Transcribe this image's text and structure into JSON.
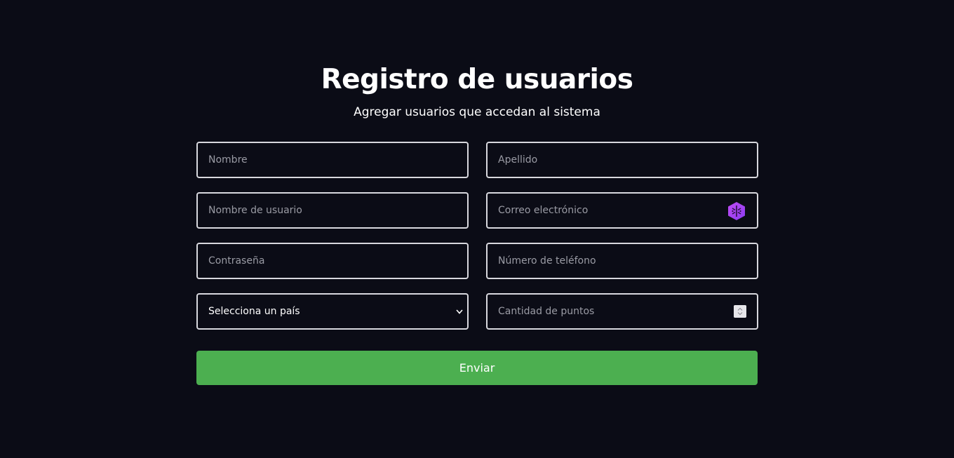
{
  "header": {
    "title": "Registro de usuarios",
    "subtitle": "Agregar usuarios que accedan al sistema"
  },
  "form": {
    "nombre": {
      "placeholder": "Nombre",
      "value": ""
    },
    "apellido": {
      "placeholder": "Apellido",
      "value": ""
    },
    "usuario": {
      "placeholder": "Nombre de usuario",
      "value": ""
    },
    "correo": {
      "placeholder": "Correo electrónico",
      "value": ""
    },
    "contrasena": {
      "placeholder": "Contraseña",
      "value": ""
    },
    "telefono": {
      "placeholder": "Número de teléfono",
      "value": ""
    },
    "pais": {
      "selected": "Selecciona un país"
    },
    "puntos": {
      "placeholder": "Cantidad de puntos",
      "value": ""
    },
    "submit_label": "Enviar"
  },
  "icons": {
    "email_extension": "password-manager-icon",
    "select_arrow": "chevron-down-icon",
    "number_spinner": "spinner-icon"
  },
  "colors": {
    "background": "#0b0c16",
    "accent": "#4caf50",
    "field_border": "#d8d8de",
    "extension_icon": "#a855f7"
  }
}
